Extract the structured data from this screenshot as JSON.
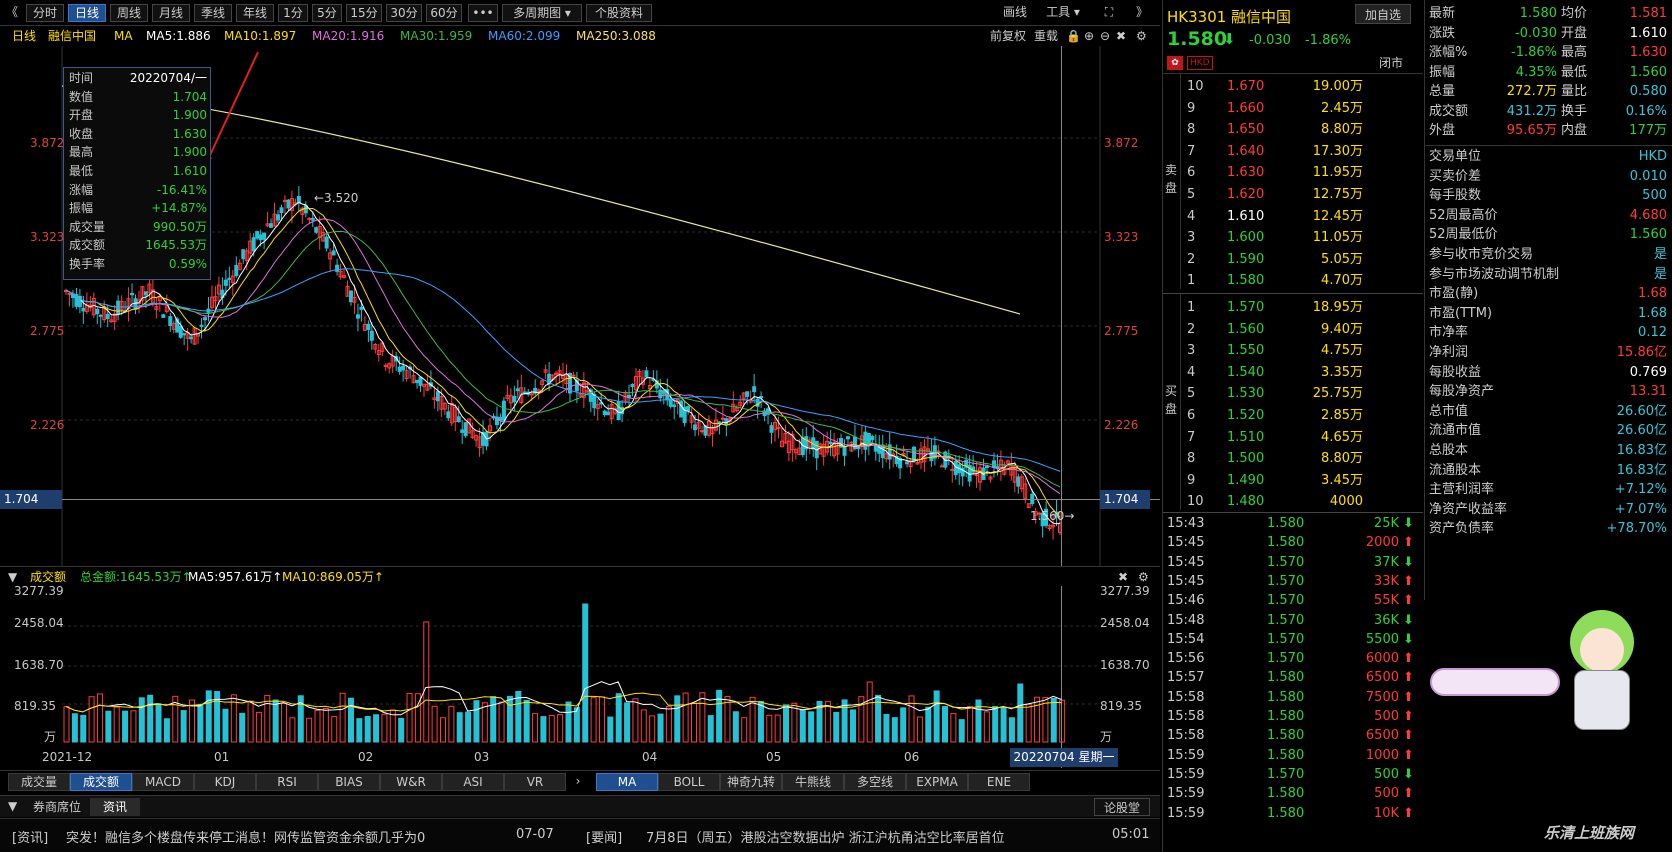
{
  "toolbar": {
    "nav_left": "《",
    "tabs": [
      "分时",
      "日线",
      "周线",
      "月线",
      "季线",
      "年线",
      "1分",
      "5分",
      "15分",
      "30分",
      "60分",
      "•••",
      "多周期图 ▾",
      "个股资料"
    ],
    "active_tab": "日线",
    "draw_label": "画线",
    "tools_label": "工具 ▾",
    "nav_right": "》"
  },
  "ma_line": {
    "period": "日线",
    "name": "融信中国",
    "ma_label": "MA",
    "ma5": "MA5:1.886",
    "ma10": "MA10:1.897",
    "ma20": "MA20:1.916",
    "ma30": "MA30:1.959",
    "ma60": "MA60:2.099",
    "ma250": "MA250:3.088",
    "adjust": "前复权",
    "overlay": "重载"
  },
  "axis": {
    "left": [
      "3.872",
      "3.323",
      "2.775",
      "2.226",
      "1.704"
    ],
    "right": [
      "3.872",
      "3.323",
      "2.775",
      "2.226",
      "1.704"
    ],
    "high_mark": "←3.520",
    "low_mark": "1.560→"
  },
  "tooltip": [
    {
      "k": "时间",
      "v": "20220704/一"
    },
    {
      "k": "数值",
      "v": "1.704"
    },
    {
      "k": "开盘",
      "v": "1.900"
    },
    {
      "k": "收盘",
      "v": "1.630"
    },
    {
      "k": "最高",
      "v": "1.900"
    },
    {
      "k": "最低",
      "v": "1.610"
    },
    {
      "k": "涨幅",
      "v": "-16.41%"
    },
    {
      "k": "振幅",
      "v": "+14.87%"
    },
    {
      "k": "成交量",
      "v": "990.50万"
    },
    {
      "k": "成交额",
      "v": "1645.53万"
    },
    {
      "k": "换手率",
      "v": "0.59%"
    }
  ],
  "volume_head": {
    "title": "成交额",
    "total": "总金额:1645.53万↑",
    "ma5": "MA5:957.61万↑",
    "ma10": "MA10:869.05万↑"
  },
  "volume_axis": [
    "3277.39",
    "2458.04",
    "1638.70",
    "819.35",
    "万"
  ],
  "x_axis": [
    "2021-12",
    "01",
    "02",
    "03",
    "04",
    "05",
    "06"
  ],
  "date_box": "20220704 星期一",
  "indicator_tabs_left": [
    "成交量",
    "成交额",
    "MACD",
    "KDJ",
    "RSI",
    "BIAS",
    "W&R",
    "ASI",
    "VR"
  ],
  "indicator_tabs_right": [
    "MA",
    "BOLL",
    "神奇九转",
    "牛熊线",
    "多空线",
    "EXPMA",
    "ENE"
  ],
  "active_indicator_left": "成交额",
  "active_indicator_right": "MA",
  "news_tabs": [
    "券商席位",
    "资讯"
  ],
  "news_more": "论股堂",
  "news": [
    {
      "tag": "[资讯]",
      "title": "突发！融信多个楼盘传来停工消息！网传监管资金余额几乎为0",
      "date": "07-07"
    },
    {
      "tag": "[要闻]",
      "title": "7月8日（周五）港股沽空数据出炉 浙江沪杭甬沽空比率居首位",
      "date": "05:01"
    }
  ],
  "quote": {
    "code": "HK3301 融信中国",
    "price": "1.580",
    "arrow": "⬇",
    "change": "-0.030",
    "change_pct": "-1.86%",
    "add_watch": "加自选",
    "market_tag": "HKD",
    "status": "闭市"
  },
  "sell_label": "卖盘",
  "buy_label": "买盘",
  "asks": [
    {
      "lvl": "10",
      "price": "1.670",
      "vol": "19.00万"
    },
    {
      "lvl": "9",
      "price": "1.660",
      "vol": "2.45万"
    },
    {
      "lvl": "8",
      "price": "1.650",
      "vol": "8.80万"
    },
    {
      "lvl": "7",
      "price": "1.640",
      "vol": "17.30万"
    },
    {
      "lvl": "6",
      "price": "1.630",
      "vol": "11.95万"
    },
    {
      "lvl": "5",
      "price": "1.620",
      "vol": "12.75万"
    },
    {
      "lvl": "4",
      "price": "1.610",
      "vol": "12.45万"
    },
    {
      "lvl": "3",
      "price": "1.600",
      "vol": "11.05万"
    },
    {
      "lvl": "2",
      "price": "1.590",
      "vol": "5.05万"
    },
    {
      "lvl": "1",
      "price": "1.580",
      "vol": "4.70万"
    }
  ],
  "bids": [
    {
      "lvl": "1",
      "price": "1.570",
      "vol": "18.95万"
    },
    {
      "lvl": "2",
      "price": "1.560",
      "vol": "9.40万"
    },
    {
      "lvl": "3",
      "price": "1.550",
      "vol": "4.75万"
    },
    {
      "lvl": "4",
      "price": "1.540",
      "vol": "3.35万"
    },
    {
      "lvl": "5",
      "price": "1.530",
      "vol": "25.75万"
    },
    {
      "lvl": "6",
      "price": "1.520",
      "vol": "2.85万"
    },
    {
      "lvl": "7",
      "price": "1.510",
      "vol": "4.65万"
    },
    {
      "lvl": "8",
      "price": "1.500",
      "vol": "8.80万"
    },
    {
      "lvl": "9",
      "price": "1.490",
      "vol": "3.45万"
    },
    {
      "lvl": "10",
      "price": "1.480",
      "vol": "4000"
    }
  ],
  "ticks": [
    {
      "t": "15:43",
      "p": "1.580",
      "v": "25K",
      "d": "down"
    },
    {
      "t": "15:45",
      "p": "1.580",
      "v": "2000",
      "d": "up"
    },
    {
      "t": "15:45",
      "p": "1.570",
      "v": "37K",
      "d": "down"
    },
    {
      "t": "15:45",
      "p": "1.570",
      "v": "33K",
      "d": "up"
    },
    {
      "t": "15:46",
      "p": "1.570",
      "v": "55K",
      "d": "up"
    },
    {
      "t": "15:48",
      "p": "1.570",
      "v": "36K",
      "d": "down"
    },
    {
      "t": "15:54",
      "p": "1.570",
      "v": "5500",
      "d": "down"
    },
    {
      "t": "15:56",
      "p": "1.570",
      "v": "6000",
      "d": "up"
    },
    {
      "t": "15:57",
      "p": "1.580",
      "v": "6500",
      "d": "up"
    },
    {
      "t": "15:58",
      "p": "1.580",
      "v": "7500",
      "d": "up"
    },
    {
      "t": "15:58",
      "p": "1.580",
      "v": "500",
      "d": "up"
    },
    {
      "t": "15:58",
      "p": "1.580",
      "v": "6500",
      "d": "up"
    },
    {
      "t": "15:59",
      "p": "1.580",
      "v": "1000",
      "d": "up"
    },
    {
      "t": "15:59",
      "p": "1.570",
      "v": "500",
      "d": "down"
    },
    {
      "t": "15:59",
      "p": "1.580",
      "v": "500",
      "d": "up"
    },
    {
      "t": "15:59",
      "p": "1.580",
      "v": "10K",
      "d": "up"
    }
  ],
  "fundamentals": [
    [
      {
        "k": "最新",
        "v": "1.580",
        "c": "green"
      },
      {
        "k": "均价",
        "v": "1.581",
        "c": "red"
      }
    ],
    [
      {
        "k": "涨跌",
        "v": "-0.030",
        "c": "green"
      },
      {
        "k": "开盘",
        "v": "1.610",
        "c": "white"
      }
    ],
    [
      {
        "k": "涨幅%",
        "v": "-1.86%",
        "c": "green"
      },
      {
        "k": "最高",
        "v": "1.630",
        "c": "red"
      }
    ],
    [
      {
        "k": "振幅",
        "v": "4.35%",
        "c": "green"
      },
      {
        "k": "最低",
        "v": "1.560",
        "c": "green"
      }
    ],
    [
      {
        "k": "总量",
        "v": "272.7万",
        "c": "yellow"
      },
      {
        "k": "量比",
        "v": "0.580",
        "c": "cyan"
      }
    ],
    [
      {
        "k": "成交额",
        "v": "431.2万",
        "c": "cyan"
      },
      {
        "k": "换手",
        "v": "0.16%",
        "c": "cyan"
      }
    ],
    [
      {
        "k": "外盘",
        "v": "95.65万",
        "c": "red"
      },
      {
        "k": "内盘",
        "v": "177万",
        "c": "green"
      }
    ]
  ],
  "info_rows": [
    {
      "k": "交易单位",
      "v": "HKD",
      "c": "cyan"
    },
    {
      "k": "买卖价差",
      "v": "0.010",
      "c": "cyan"
    },
    {
      "k": "每手股数",
      "v": "500",
      "c": "cyan"
    },
    {
      "k": "52周最高价",
      "v": "4.680",
      "c": "red"
    },
    {
      "k": "52周最低价",
      "v": "1.560",
      "c": "green"
    },
    {
      "k": "参与收市竞价交易",
      "v": "是",
      "c": "cyan"
    },
    {
      "k": "参与市场波动调节机制",
      "v": "是",
      "c": "cyan"
    },
    {
      "k": "市盈(静)",
      "v": "1.68",
      "c": "red"
    },
    {
      "k": "市盈(TTM)",
      "v": "1.68",
      "c": "cyan"
    },
    {
      "k": "市净率",
      "v": "0.12",
      "c": "cyan"
    },
    {
      "k": "净利润",
      "v": "15.86亿",
      "c": "red"
    },
    {
      "k": "每股收益",
      "v": "0.769",
      "c": "white"
    },
    {
      "k": "每股净资产",
      "v": "13.31",
      "c": "red"
    },
    {
      "k": "总市值",
      "v": "26.60亿",
      "c": "cyan"
    },
    {
      "k": "流通市值",
      "v": "26.60亿",
      "c": "cyan"
    },
    {
      "k": "总股本",
      "v": "16.83亿",
      "c": "cyan"
    },
    {
      "k": "流通股本",
      "v": "16.83亿",
      "c": "cyan"
    },
    {
      "k": "主营利润率",
      "v": "+7.12%",
      "c": "cyan"
    },
    {
      "k": "净资产收益率",
      "v": "+7.07%",
      "c": "cyan"
    },
    {
      "k": "资产负债率",
      "v": "+78.70%",
      "c": "cyan"
    }
  ],
  "watermark": "乐清上班族网",
  "colors": {
    "up": "#ff3b3b",
    "down": "#2fd13b",
    "candle_down": "#25c2d6",
    "bg": "#000000",
    "accent": "#1f4f8f"
  }
}
